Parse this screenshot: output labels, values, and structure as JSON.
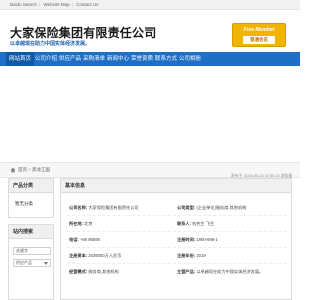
{
  "topbar": {
    "links": [
      "Baidu Search",
      "Website Map",
      "Contact Us"
    ]
  },
  "header": {
    "company_name": "大家保险集团有限责任公司",
    "slogan": "以卓越现在助力中国实体经济发展。",
    "badge_top": "Free Member",
    "badge_bottom": "普通会员"
  },
  "nav": {
    "items": [
      "网站首页",
      "公司介绍",
      "供应产品",
      "采购清单",
      "新闻中心",
      "荣誉资质",
      "联系方式",
      "公司相册"
    ]
  },
  "breadcrumb": {
    "home": "首页",
    "current": "黑龙江国",
    "timestamp": "发布于: 2015-05-22 07:55:22  浏览量"
  },
  "sidebar": {
    "products_title": "产品分类",
    "products_link": "暂无分类",
    "search_title": "站内搜索",
    "search_placeholder": "关键字",
    "search_select": "供应产品"
  },
  "main": {
    "title": "基本信息",
    "rows": [
      {
        "k1": "公司名称:",
        "v1": "大家保险集团有限责任公司",
        "k2": "公司类型:",
        "v2": "(企业单位)服务商,其他机构"
      },
      {
        "k1": "所在地:",
        "v1": "北京",
        "k2": "联系人:",
        "v2": "何先生 飞生"
      },
      {
        "k1": "电话:",
        "v1": "+86 95569",
        "k2": "注册时间:",
        "v2": "1900-696-1"
      },
      {
        "k1": "注册资本:",
        "v1": "2036000万人民币",
        "k2": "注册年份:",
        "v2": "2019"
      },
      {
        "k1": "经营模式:",
        "v1": "服务商,其他机构",
        "k2": "主营产品:",
        "v2": "以卓越现在助力中国实体经济发展。"
      }
    ]
  },
  "colors": {
    "nav_bg": "#1f6fc5",
    "nav_active": "#0f5aa8",
    "badge": "#f1b400",
    "slogan": "#1f5fa8"
  }
}
